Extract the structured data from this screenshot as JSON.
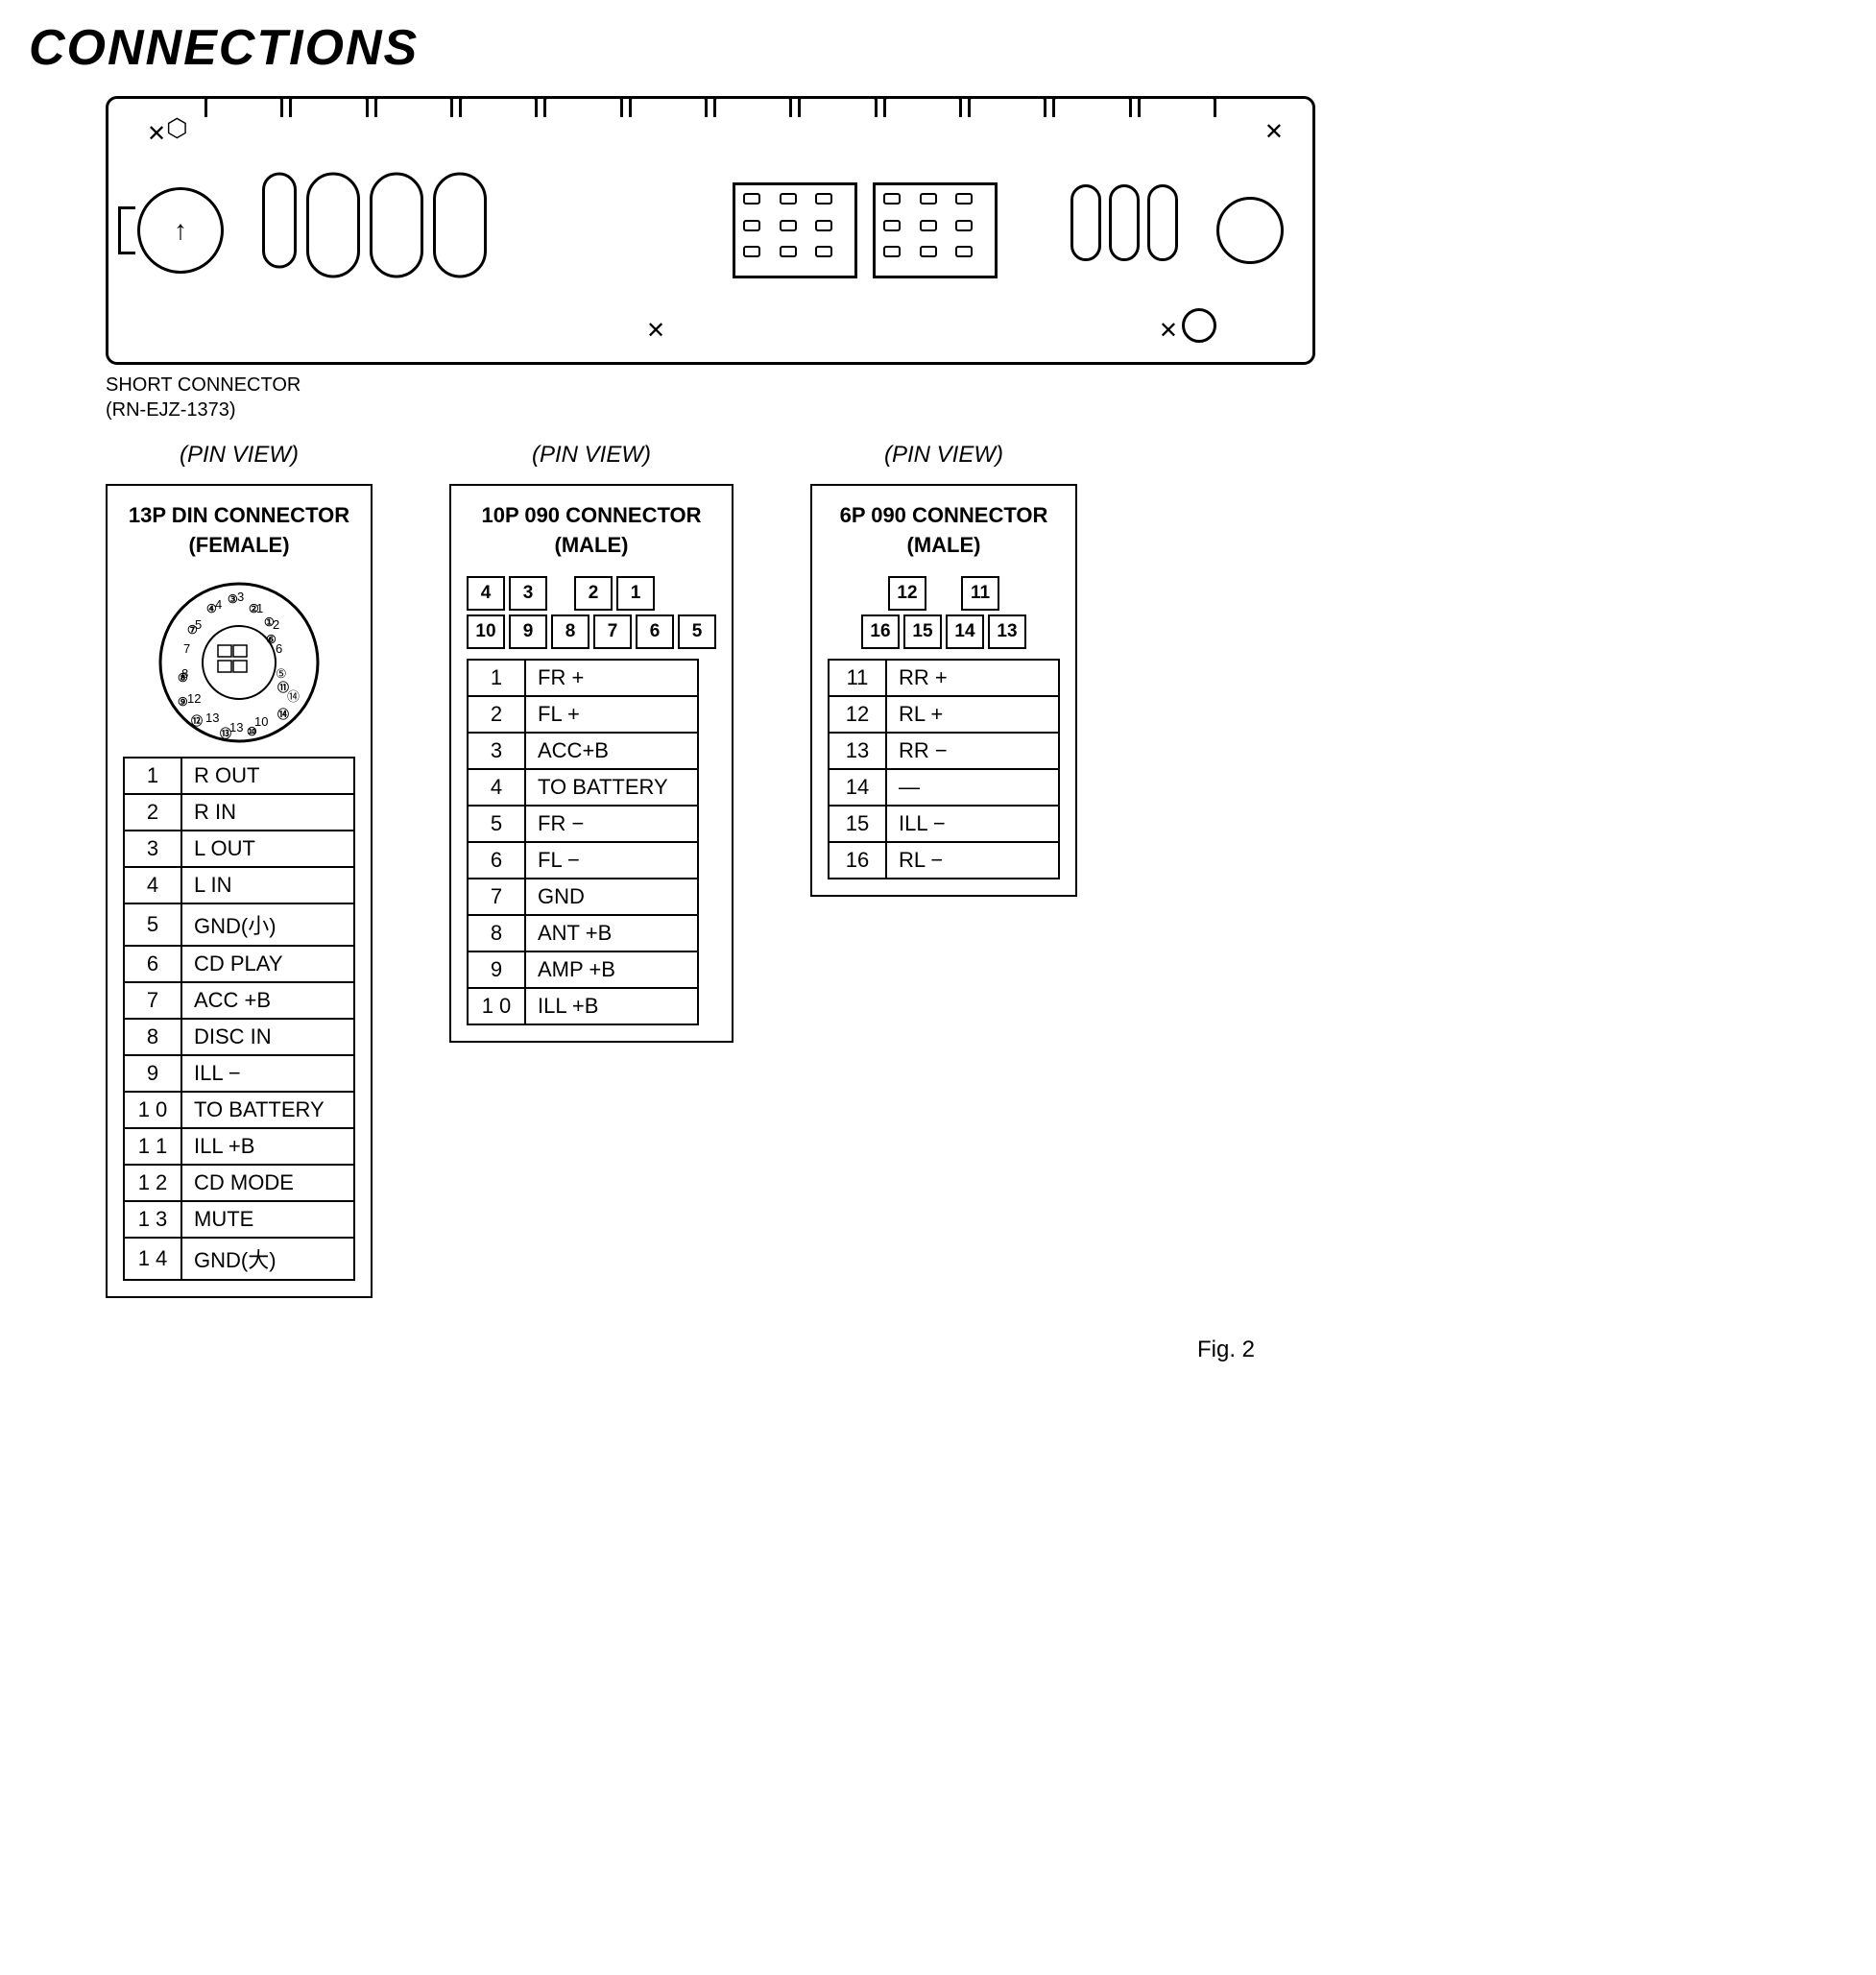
{
  "title": "CONNECTIONS",
  "device": {
    "short_connector_label": "SHORT CONNECTOR",
    "short_connector_part": "(RN-EJZ-1373)"
  },
  "pin_view_label": "(PIN  VIEW)",
  "connectors": [
    {
      "id": "13p-din",
      "title": "13P DIN CONNECTOR",
      "subtitle": "(FEMALE)",
      "pins": [
        {
          "num": "1",
          "label": "R OUT"
        },
        {
          "num": "2",
          "label": "R IN"
        },
        {
          "num": "3",
          "label": "L OUT"
        },
        {
          "num": "4",
          "label": "L IN"
        },
        {
          "num": "5",
          "label": "GND(小)"
        },
        {
          "num": "6",
          "label": "CD PLAY"
        },
        {
          "num": "7",
          "label": "ACC +B"
        },
        {
          "num": "8",
          "label": "DISC IN"
        },
        {
          "num": "9",
          "label": "ILL −"
        },
        {
          "num": "1 0",
          "label": "TO BATTERY"
        },
        {
          "num": "1 1",
          "label": "ILL +B"
        },
        {
          "num": "1 2",
          "label": "CD MODE"
        },
        {
          "num": "1 3",
          "label": "MUTE"
        },
        {
          "num": "1 4",
          "label": "GND(大)"
        }
      ]
    },
    {
      "id": "10p-090",
      "title": "10P 090 CONNECTOR",
      "subtitle": "(MALE)",
      "grid_row1": [
        "4",
        "3",
        "",
        "2",
        "1"
      ],
      "grid_row2": [
        "1 0",
        "9",
        "8",
        "7",
        "6",
        "5"
      ],
      "pins": [
        {
          "num": "1",
          "label": "FR +"
        },
        {
          "num": "2",
          "label": "FL +"
        },
        {
          "num": "3",
          "label": "ACC+B"
        },
        {
          "num": "4",
          "label": "TO BATTERY"
        },
        {
          "num": "5",
          "label": "FR −"
        },
        {
          "num": "6",
          "label": "FL −"
        },
        {
          "num": "7",
          "label": "GND"
        },
        {
          "num": "8",
          "label": "ANT +B"
        },
        {
          "num": "9",
          "label": "AMP +B"
        },
        {
          "num": "1 0",
          "label": "ILL +B"
        }
      ]
    },
    {
      "id": "6p-090",
      "title": "6P 090 CONNECTOR",
      "subtitle": "(MALE)",
      "grid_row1": [
        "12",
        "",
        "11"
      ],
      "grid_row2": [
        "16",
        "15",
        "14",
        "13"
      ],
      "pins": [
        {
          "num": "11",
          "label": "RR +"
        },
        {
          "num": "12",
          "label": "RL +"
        },
        {
          "num": "13",
          "label": "RR −"
        },
        {
          "num": "14",
          "label": "—"
        },
        {
          "num": "15",
          "label": "ILL −"
        },
        {
          "num": "16",
          "label": "RL −"
        }
      ]
    }
  ],
  "fig_label": "Fig. 2"
}
